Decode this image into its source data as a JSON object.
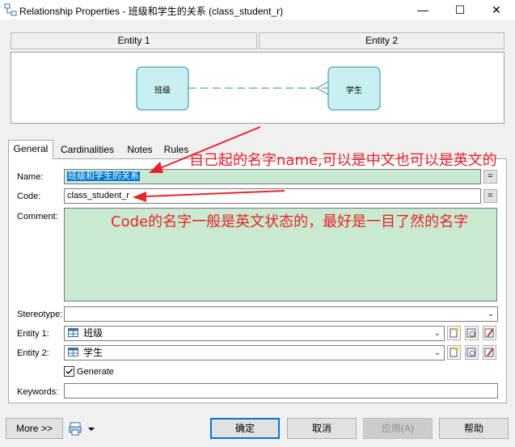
{
  "window": {
    "title": "Relationship Properties - 班级和学生的关系 (class_student_r)",
    "minimize_glyph": "—",
    "maximize_glyph": "☐",
    "close_glyph": "✕"
  },
  "entity_headers": {
    "entity1": "Entity 1",
    "entity2": "Entity 2"
  },
  "diagram": {
    "entity1_label": "班级",
    "entity2_label": "学生",
    "entity_fill": "#c8f0f0",
    "entity_border": "#2a8aa0"
  },
  "tabs": [
    {
      "label": "General",
      "active": true
    },
    {
      "label": "Cardinalities",
      "active": false
    },
    {
      "label": "Notes",
      "active": false
    },
    {
      "label": "Rules",
      "active": false
    }
  ],
  "form": {
    "name_label": "Name:",
    "name_value": "班级和学生的关系",
    "code_label": "Code:",
    "code_value": "class_student_r",
    "comment_label": "Comment:",
    "stereotype_label": "Stereotype:",
    "stereotype_value": "",
    "entity1_label": "Entity 1:",
    "entity1_value": "班级",
    "entity2_label": "Entity 2:",
    "entity2_value": "学生",
    "generate_label": "Generate",
    "generate_checked": true,
    "keywords_label": "Keywords:",
    "keywords_value": "",
    "eq_button": "="
  },
  "annotations": {
    "name_note": "自己起的名字name,可以是中文也可以是英文的",
    "code_note": "Code的名字一般是英文状态的，最好是一目了然的名字",
    "color": "#e8242a"
  },
  "buttons": {
    "more": "More >>",
    "ok": "确定",
    "cancel": "取消",
    "apply": "应用(A)",
    "help": "帮助"
  },
  "colors": {
    "comment_bg": "#c9e9d0",
    "name_highlight": "#c9e9d0",
    "selection": "#0078d7"
  }
}
